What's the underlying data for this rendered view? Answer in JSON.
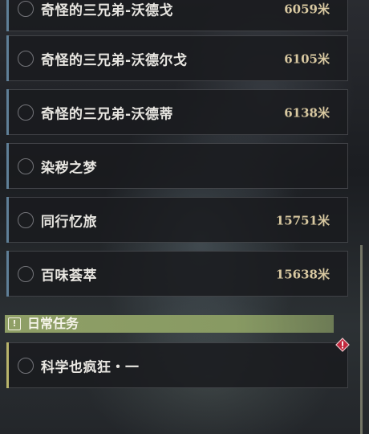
{
  "quests": [
    {
      "title": "奇怪的三兄弟-沃德戈",
      "distance": "6059米"
    },
    {
      "title": "奇怪的三兄弟-沃德尔戈",
      "distance": "6105米"
    },
    {
      "title": "奇怪的三兄弟-沃德蒂",
      "distance": "6138米"
    },
    {
      "title": "染秽之梦",
      "distance": ""
    },
    {
      "title": "同行忆旅",
      "distance": "15751米"
    },
    {
      "title": "百味荟萃",
      "distance": "15638米"
    }
  ],
  "daily_section": {
    "icon": "exclamation-box-icon",
    "icon_glyph": "!",
    "label": "日常任务"
  },
  "daily_quests": [
    {
      "title": "科学也疯狂・一",
      "badge": "new-quest-diamond-icon"
    }
  ],
  "colors": {
    "section_bar": "#8f9f66",
    "distance_text": "#d9c9a1",
    "badge": "#c2273d"
  }
}
